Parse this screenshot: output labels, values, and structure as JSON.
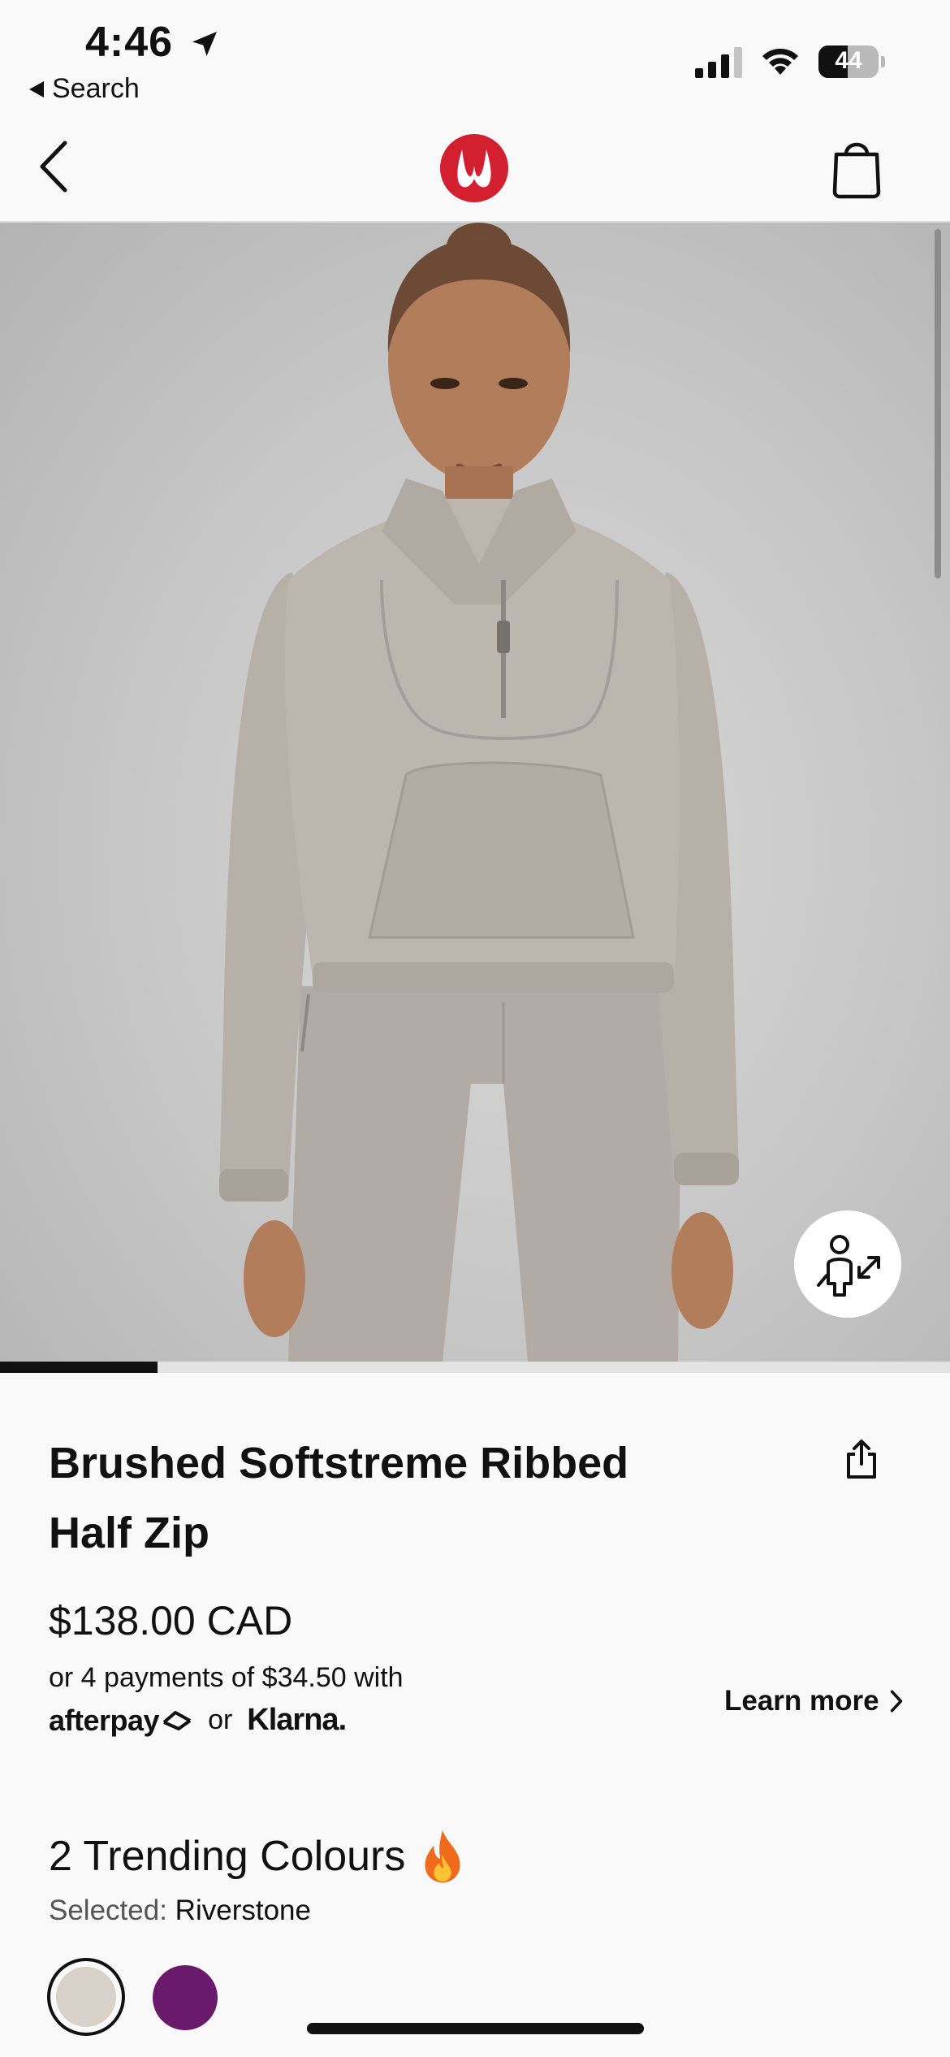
{
  "status_bar": {
    "time": "4:46",
    "back_app_label": "Search",
    "battery_percent": "44"
  },
  "nav": {
    "back_icon": "chevron-left-icon",
    "logo": "lululemon-logo",
    "bag_icon": "shopping-bag-icon"
  },
  "gallery": {
    "current_image_index": 1,
    "total_images": 6,
    "progress_fraction": 0.166,
    "fit_button_icon": "size-fit-icon"
  },
  "product": {
    "title": "Brushed Softstreme Ribbed Half Zip",
    "share_icon": "share-icon",
    "price": "$138.00 CAD",
    "payments_text": "or 4 payments of $34.50 with",
    "afterpay_label": "afterpay",
    "or_label": "or",
    "klarna_label": "Klarna.",
    "learn_more": "Learn more"
  },
  "colours": {
    "heading": "2 Trending Colours",
    "heading_icon": "fire-icon",
    "selected_label": "Selected:",
    "selected_value": "Riverstone",
    "swatches": [
      {
        "name": "Riverstone",
        "color": "#d9d2ca",
        "selected": true
      },
      {
        "name": "purple",
        "color": "#6a1a6b",
        "selected": false
      }
    ]
  },
  "colors": {
    "brand_red": "#d22030",
    "text": "#111111",
    "background": "#f9f9f9"
  }
}
